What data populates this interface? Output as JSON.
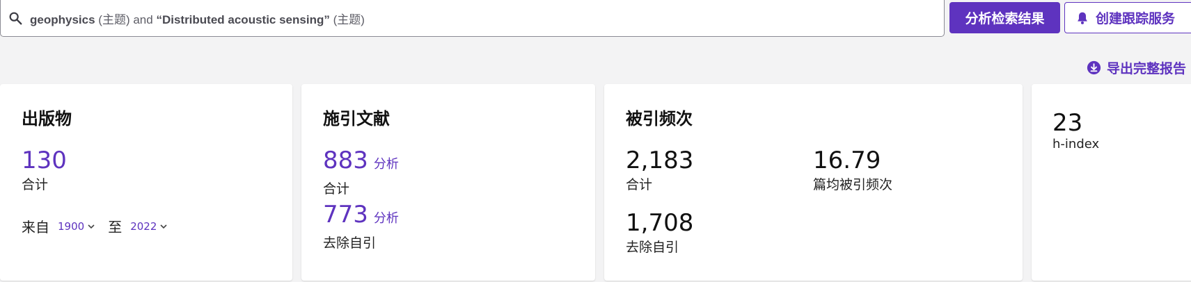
{
  "search": {
    "term1": "geophysics",
    "field1": "(主题)",
    "connector": "and",
    "term2": "“Distributed acoustic sensing”",
    "field2": "(主题)"
  },
  "toolbar": {
    "analyze_label": "分析检索结果",
    "track_label": "创建跟踪服务",
    "export_label": "导出完整报告"
  },
  "publications": {
    "title": "出版物",
    "total": "130",
    "total_caption": "合计",
    "from_label": "来自",
    "from_year": "1900",
    "to_label": "至",
    "to_year": "2022"
  },
  "citing": {
    "title": "施引文献",
    "total": "883",
    "total_link": "分析",
    "total_caption": "合计",
    "excl": "773",
    "excl_link": "分析",
    "excl_caption": "去除自引"
  },
  "times_cited": {
    "title": "被引频次",
    "total": "2,183",
    "total_caption": "合计",
    "average": "16.79",
    "average_caption": "篇均被引频次",
    "excl": "1,708",
    "excl_caption": "去除自引"
  },
  "h_index": {
    "value": "23",
    "caption": "h-index"
  },
  "colors": {
    "accent": "#5e33bf",
    "background": "#f3f3f4"
  }
}
